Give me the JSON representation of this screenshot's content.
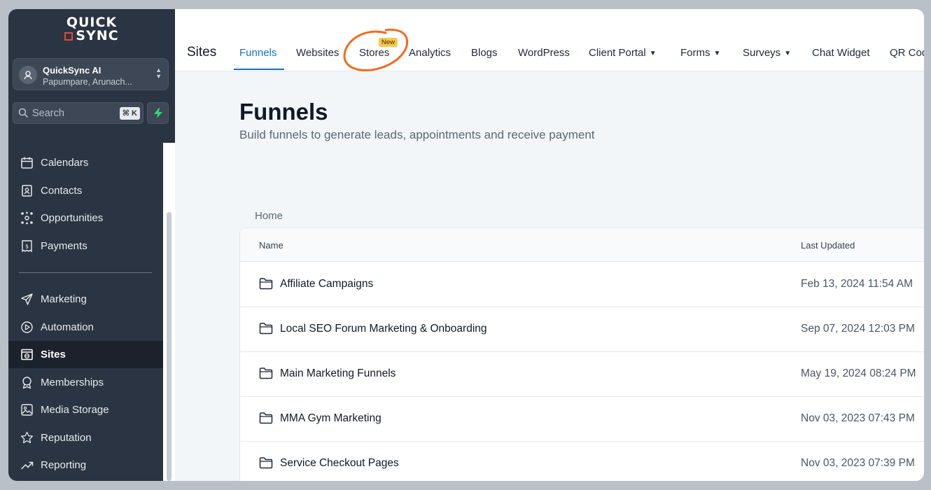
{
  "brand": {
    "logo_line1": "QUICK",
    "logo_line2": "SYNC"
  },
  "account": {
    "name": "QuickSync AI",
    "location": "Papumpare, Arunach..."
  },
  "search": {
    "placeholder": "Search",
    "shortcut": "⌘ K"
  },
  "sidebar": {
    "items": [
      {
        "label": "Calendars",
        "icon": "calendar-icon"
      },
      {
        "label": "Contacts",
        "icon": "contacts-icon"
      },
      {
        "label": "Opportunities",
        "icon": "opportunities-icon"
      },
      {
        "label": "Payments",
        "icon": "payments-icon"
      },
      {
        "label": "Marketing",
        "icon": "send-icon"
      },
      {
        "label": "Automation",
        "icon": "automation-icon"
      },
      {
        "label": "Sites",
        "icon": "sites-icon",
        "active": true
      },
      {
        "label": "Memberships",
        "icon": "award-icon"
      },
      {
        "label": "Media Storage",
        "icon": "image-icon"
      },
      {
        "label": "Reputation",
        "icon": "star-icon"
      },
      {
        "label": "Reporting",
        "icon": "trend-icon"
      }
    ]
  },
  "topbar": {
    "title": "Sites",
    "tabs": [
      {
        "label": "Funnels",
        "active": true
      },
      {
        "label": "Websites"
      },
      {
        "label": "Stores",
        "badge": "New"
      },
      {
        "label": "Analytics"
      },
      {
        "label": "Blogs"
      },
      {
        "label": "WordPress"
      },
      {
        "label": "Client Portal",
        "dropdown": true
      },
      {
        "label": "Forms",
        "dropdown": true
      },
      {
        "label": "Surveys",
        "dropdown": true
      },
      {
        "label": "Chat Widget"
      },
      {
        "label": "QR Cod"
      }
    ]
  },
  "main": {
    "title": "Funnels",
    "subtitle": "Build funnels to generate leads, appointments and receive payment",
    "breadcrumb": "Home",
    "table": {
      "columns": [
        "Name",
        "Last Updated"
      ],
      "rows": [
        {
          "name": "Affiliate Campaigns",
          "updated": "Feb 13, 2024 11:54 AM"
        },
        {
          "name": "Local SEO Forum Marketing & Onboarding",
          "updated": "Sep 07, 2024 12:03 PM"
        },
        {
          "name": "Main Marketing Funnels",
          "updated": "May 19, 2024 08:24 PM"
        },
        {
          "name": "MMA Gym Marketing",
          "updated": "Nov 03, 2023 07:43 PM"
        },
        {
          "name": "Service Checkout Pages",
          "updated": "Nov 03, 2023 07:39 PM"
        }
      ]
    }
  },
  "colors": {
    "sidebar": "#2b3442",
    "accent": "#1570c9",
    "badge": "#f7c84a",
    "highlight": "#f26b1d"
  }
}
